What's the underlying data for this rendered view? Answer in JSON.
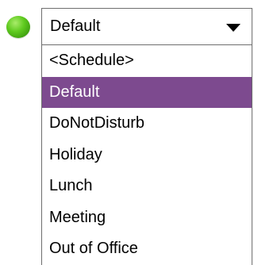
{
  "status": {
    "color": "#5fca1f",
    "icon": "status-online-dot"
  },
  "dropdown": {
    "selected_value": "Default",
    "arrow_icon": "triangle-down"
  },
  "options": [
    {
      "label": "<Schedule>",
      "selected": false
    },
    {
      "label": "Default",
      "selected": true
    },
    {
      "label": "DoNotDisturb",
      "selected": false
    },
    {
      "label": "Holiday",
      "selected": false
    },
    {
      "label": "Lunch",
      "selected": false
    },
    {
      "label": "Meeting",
      "selected": false
    },
    {
      "label": "Out of Office",
      "selected": false
    }
  ],
  "colors": {
    "highlight_background": "#7d4a8f",
    "highlight_text": "#ffffff",
    "border": "#6f6f6f"
  }
}
